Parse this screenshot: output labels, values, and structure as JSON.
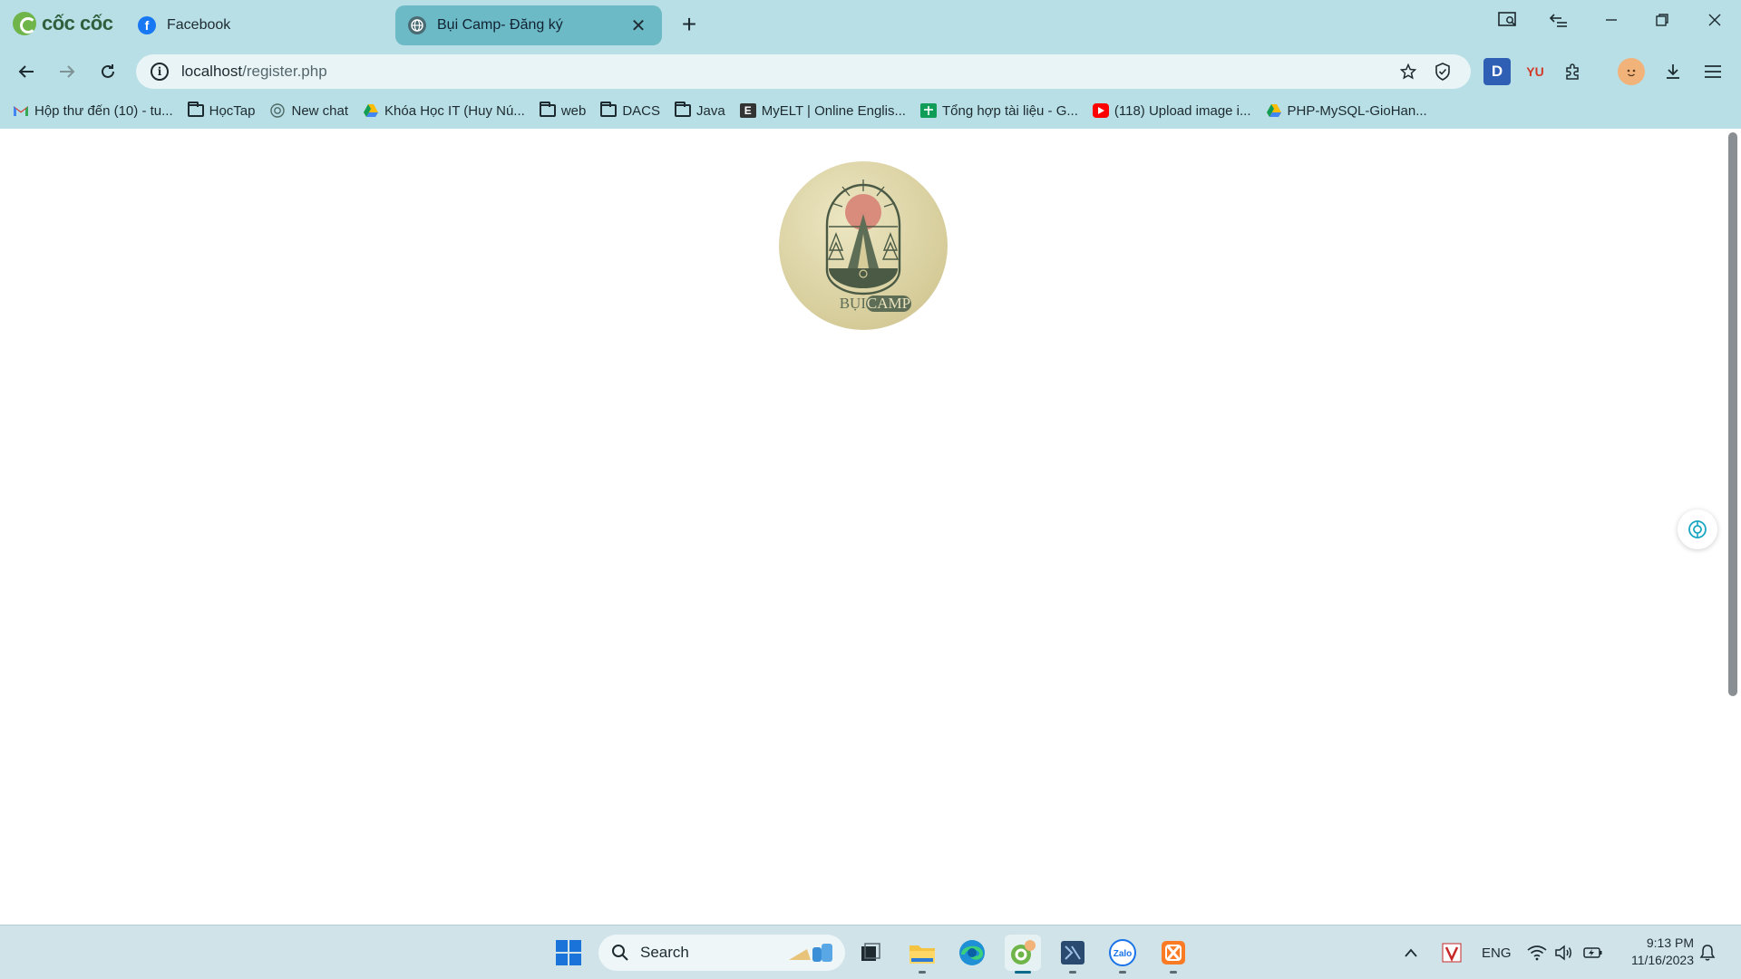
{
  "browser": {
    "brand": "cốc cốc",
    "tabs": [
      {
        "title": "Facebook",
        "active": false
      },
      {
        "title": "Bụi Camp- Đăng ký",
        "active": true
      }
    ],
    "new_tab_label": "+",
    "url": {
      "host": "localhost",
      "path": "/register.php"
    },
    "bookmarks": [
      {
        "label": "Hộp thư đến (10) - tu...",
        "icon": "gmail-icon"
      },
      {
        "label": "HọcTap",
        "icon": "folder-icon"
      },
      {
        "label": "New chat",
        "icon": "chatgpt-icon"
      },
      {
        "label": "Khóa Học IT (Huy Nú...",
        "icon": "drive-icon"
      },
      {
        "label": "web",
        "icon": "folder-icon"
      },
      {
        "label": "DACS",
        "icon": "folder-icon"
      },
      {
        "label": "Java",
        "icon": "folder-icon"
      },
      {
        "label": "MyELT | Online Englis...",
        "icon": "myelt-icon"
      },
      {
        "label": "Tổng hợp tài liệu - G...",
        "icon": "sheets-icon"
      },
      {
        "label": "(118) Upload image i...",
        "icon": "youtube-icon"
      },
      {
        "label": "PHP-MySQL-GioHan...",
        "icon": "drive-icon"
      }
    ],
    "extensions": {
      "d_label": "D",
      "yu_label": "YU"
    }
  },
  "page": {
    "logo_text": "BỤICAMP",
    "logo_parts": {
      "left": "BỤI",
      "right": "CAMP"
    }
  },
  "taskbar": {
    "search_placeholder": "Search",
    "language": "ENG",
    "time": "9:13 PM",
    "date": "11/16/2023"
  },
  "colors": {
    "chrome_bg": "#b8dfe6",
    "active_tab": "#6cbac6",
    "logo_bg": "#d6cc9a",
    "logo_line": "#4a5a45",
    "sun": "#d98c7c"
  }
}
